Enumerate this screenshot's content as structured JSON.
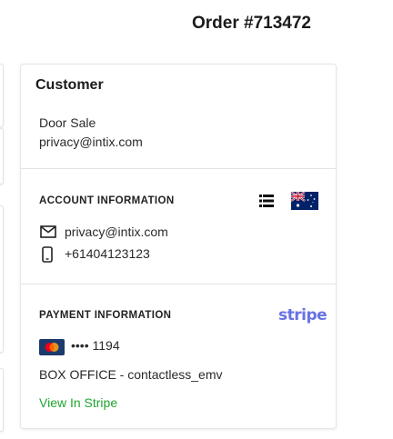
{
  "header": {
    "order_title": "Order #713472"
  },
  "customer_card": {
    "title": "Customer",
    "name": "Door Sale",
    "email": "privacy@intix.com"
  },
  "account_information": {
    "title": "ACCOUNT INFORMATION",
    "list_icon": "list-icon",
    "flag_icon": "australia-flag-icon",
    "email_icon": "mail-icon",
    "email": "privacy@intix.com",
    "phone_icon": "mobile-phone-icon",
    "phone": "+61404123123"
  },
  "payment_information": {
    "title": "PAYMENT INFORMATION",
    "provider_logo": "stripe",
    "card_icon": "mastercard-icon",
    "card_last4": "•••• 1194",
    "payment_method": "BOX OFFICE - contactless_emv",
    "view_link": "View In Stripe"
  },
  "colors": {
    "link_green": "#1fa62e",
    "stripe_purple": "#6772e5"
  }
}
